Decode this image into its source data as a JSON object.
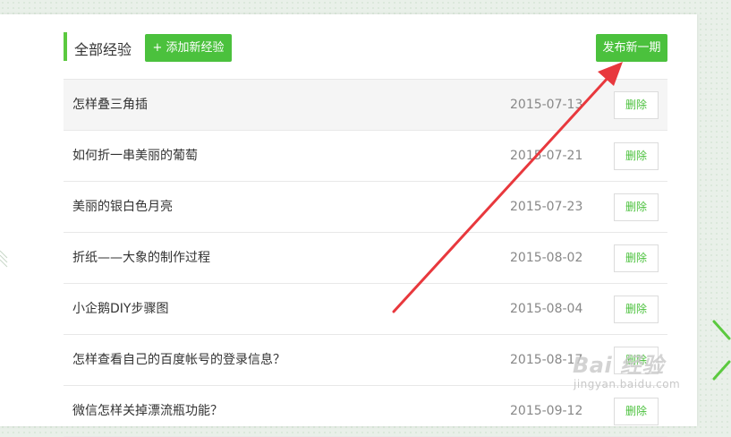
{
  "header": {
    "title": "全部经验",
    "add_button": "+ 添加新经验",
    "publish_button": "发布新一期"
  },
  "experiences": [
    {
      "title": "怎样叠三角插",
      "date": "2015-07-13",
      "action": "删除"
    },
    {
      "title": "如何折一串美丽的葡萄",
      "date": "2015-07-21",
      "action": "删除"
    },
    {
      "title": "美丽的银白色月亮",
      "date": "2015-07-23",
      "action": "删除"
    },
    {
      "title": "折纸——大象的制作过程",
      "date": "2015-08-02",
      "action": "删除"
    },
    {
      "title": "小企鹅DIY步骤图",
      "date": "2015-08-04",
      "action": "删除"
    },
    {
      "title": "怎样查看自己的百度帐号的登录信息？",
      "date": "2015-08-17",
      "action": "删除"
    },
    {
      "title": "微信怎样关掉漂流瓶功能？",
      "date": "2015-09-12",
      "action": "删除"
    }
  ],
  "watermark": {
    "main": "Bai 经验",
    "sub": "jingyan.baidu.com"
  },
  "colors": {
    "accent": "#4bc13d",
    "arrow": "#e8383d"
  }
}
